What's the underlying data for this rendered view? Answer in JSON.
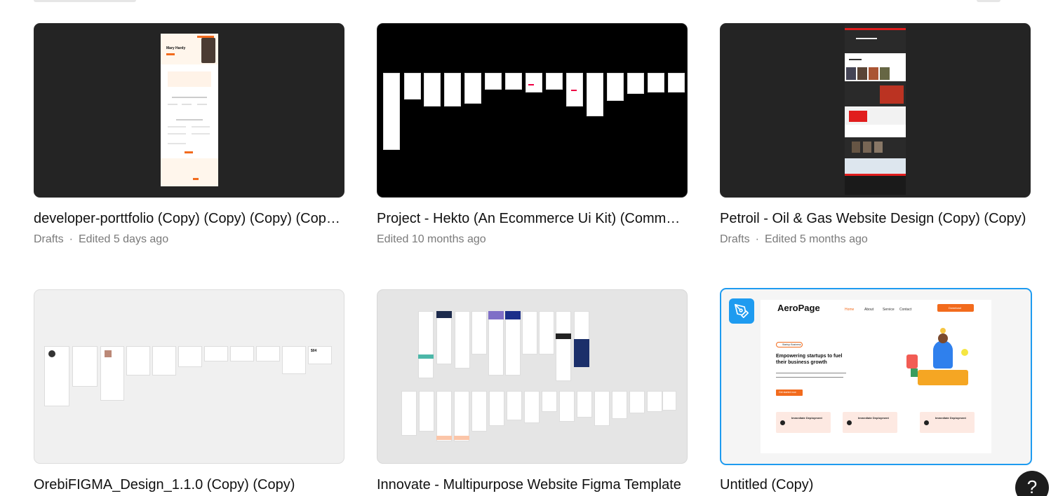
{
  "files": [
    {
      "title": "developer-porttfolio (Copy) (Copy) (Copy) (Copy) (Copy)",
      "location": "Drafts",
      "separator": "·",
      "edited": "Edited 5 days ago"
    },
    {
      "title": "Project - Hekto (An Ecommerce Ui Kit) (Community)",
      "location": "",
      "separator": "",
      "edited": "Edited 10 months ago"
    },
    {
      "title": "Petroil - Oil & Gas Website Design (Copy) (Copy)",
      "location": "Drafts",
      "separator": "·",
      "edited": "Edited 5 months ago"
    },
    {
      "title": "OrebiFIGMA_Design_1.1.0 (Copy) (Copy)",
      "location": "",
      "separator": "",
      "edited": ""
    },
    {
      "title": "Innovate - Multipurpose Website Figma Template",
      "location": "",
      "separator": "",
      "edited": ""
    },
    {
      "title": "Untitled (Copy)",
      "location": "",
      "separator": "",
      "edited": ""
    }
  ],
  "thumb_text": {
    "portfolio_name": "Mary Hardy",
    "aero_logo": "AeroPage",
    "aero_nav": [
      "Home",
      "About",
      "Service",
      "Contact"
    ],
    "aero_download": "Download",
    "aero_tag": "Startup Business",
    "aero_headline": "Empowering startups to fuel their business growth",
    "aero_cta": "Get started now",
    "aero_feature": "Immediate Deployment",
    "orebi_price": "$04"
  },
  "help": {
    "label": "?"
  },
  "colors": {
    "accent": "#1e9bf0",
    "orange": "#f26b1d",
    "red": "#e11d1d"
  },
  "icons": {
    "pen": "pen-tool-icon",
    "help": "question-icon"
  }
}
